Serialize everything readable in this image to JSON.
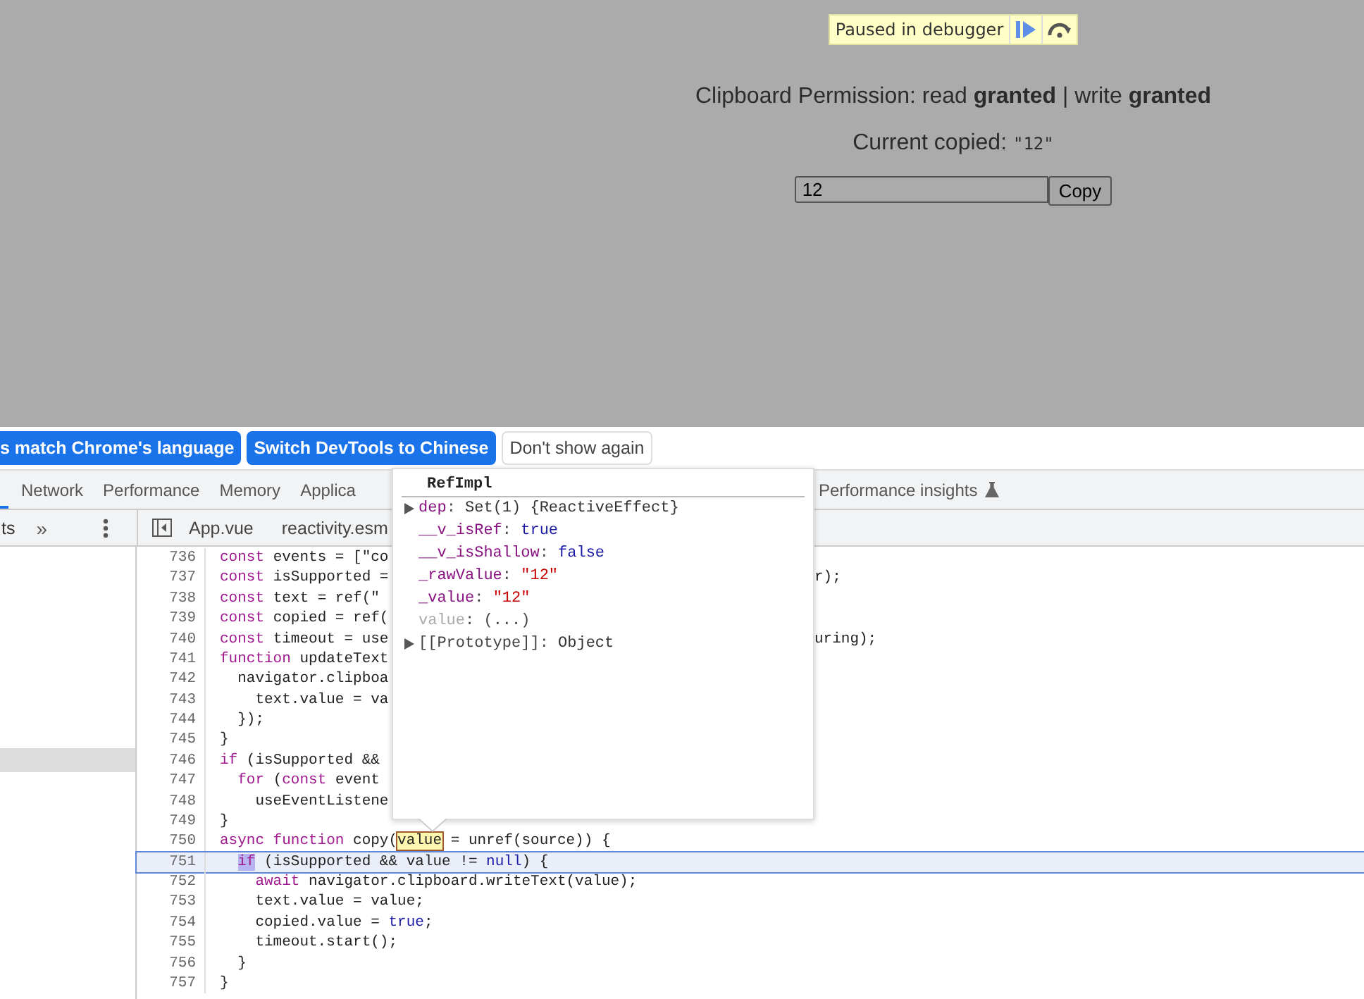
{
  "page": {
    "debugger_badge": {
      "label": "Paused in debugger"
    },
    "permission": "Clipboard Permission: read **granted** | write **granted**",
    "copied_label": "Current copied: ",
    "copied_value": "\"12\"",
    "input": {
      "value": "12"
    },
    "copy_button": "Copy"
  },
  "infobar": {
    "buttons": [
      {
        "label": "s match Chrome's language",
        "kind": "primary"
      },
      {
        "label": "Switch DevTools to Chinese",
        "kind": "primary"
      },
      {
        "label": "Don't show again",
        "kind": "plain"
      }
    ]
  },
  "tabs": [
    {
      "label": "Network",
      "selected": false
    },
    {
      "label": "Performance",
      "selected": false
    },
    {
      "label": "Memory",
      "selected": false
    },
    {
      "label": "Applica",
      "selected": false
    }
  ],
  "tabs_right": [
    {
      "label": "Performance insights",
      "experimental": true
    }
  ],
  "navigator": {
    "label": "ts",
    "more": "»"
  },
  "file_tabs": [
    {
      "label": "App.vue"
    },
    {
      "label": "reactivity.esm"
    }
  ],
  "code_lines": [
    {
      "no": "736",
      "current": false,
      "code": [
        {
          "text": "const",
          "kind": "keyword"
        },
        {
          "text": " events = [\"co"
        }
      ]
    },
    {
      "no": "737",
      "current": false,
      "code": [
        {
          "text": "const",
          "kind": "keyword"
        },
        {
          "text": " isSupported ="
        }
      ],
      "tail": "r);"
    },
    {
      "no": "738",
      "current": false,
      "code": [
        {
          "text": "const",
          "kind": "keyword"
        },
        {
          "text": " text = ref(\""
        }
      ]
    },
    {
      "no": "739",
      "current": false,
      "code": [
        {
          "text": "const",
          "kind": "keyword"
        },
        {
          "text": " copied = ref("
        }
      ]
    },
    {
      "no": "740",
      "current": false,
      "code": [
        {
          "text": "const",
          "kind": "keyword"
        },
        {
          "text": " timeout = use"
        }
      ],
      "tail": "uring);"
    },
    {
      "no": "741",
      "current": false,
      "code": [
        {
          "text": "function",
          "kind": "keyword"
        },
        {
          "text": " updateText"
        }
      ]
    },
    {
      "no": "742",
      "current": false,
      "code": [
        {
          "text": "  navigator.clipboa"
        }
      ]
    },
    {
      "no": "743",
      "current": false,
      "code": [
        {
          "text": "    text.value = va"
        }
      ]
    },
    {
      "no": "744",
      "current": false,
      "code": [
        {
          "text": "  });"
        }
      ]
    },
    {
      "no": "745",
      "current": false,
      "code": [
        {
          "text": "}"
        }
      ]
    },
    {
      "no": "746",
      "current": false,
      "code": [
        {
          "text": "if",
          "kind": "keyword"
        },
        {
          "text": " (isSupported &&"
        }
      ]
    },
    {
      "no": "747",
      "current": false,
      "code": [
        {
          "text": "  for",
          "kind": "keyword"
        },
        {
          "text": " ("
        },
        {
          "text": "const",
          "kind": "keyword"
        },
        {
          "text": " event"
        }
      ]
    },
    {
      "no": "748",
      "current": false,
      "code": [
        {
          "text": "    useEventListene"
        }
      ]
    },
    {
      "no": "749",
      "current": false,
      "code": [
        {
          "text": "}"
        }
      ]
    },
    {
      "no": "750",
      "current": false,
      "code": [
        {
          "text": "async function",
          "kind": "keyword"
        },
        {
          "text": " copy("
        },
        {
          "text": "value",
          "kind": "hovered"
        },
        {
          "text": " = unref(source)) {"
        }
      ]
    },
    {
      "no": "751",
      "current": true,
      "code": [
        {
          "text": "  if",
          "kind": "paused"
        },
        {
          "text": " (isSupported && value != "
        },
        {
          "text": "null",
          "kind": "literal"
        },
        {
          "text": ") {"
        }
      ]
    },
    {
      "no": "752",
      "current": false,
      "code": [
        {
          "text": "    await",
          "kind": "keyword"
        },
        {
          "text": " navigator.clipboard.writeText(value);"
        }
      ]
    },
    {
      "no": "753",
      "current": false,
      "code": [
        {
          "text": "    text.value = value;"
        }
      ]
    },
    {
      "no": "754",
      "current": false,
      "code": [
        {
          "text": "    copied.value = "
        },
        {
          "text": "true",
          "kind": "literal"
        },
        {
          "text": ";"
        }
      ]
    },
    {
      "no": "755",
      "current": false,
      "code": [
        {
          "text": "    timeout.start();"
        }
      ]
    },
    {
      "no": "756",
      "current": false,
      "code": [
        {
          "text": "  }"
        }
      ]
    },
    {
      "no": "757",
      "current": false,
      "code": [
        {
          "text": "}"
        }
      ]
    }
  ],
  "popover": {
    "title": "RefImpl",
    "properties": [
      {
        "name": {
          "text": "dep",
          "kind": "own"
        },
        "sep": ": ",
        "value": {
          "text": "Set(1) {ReactiveEffect}",
          "kind": "object"
        },
        "expandable": true
      },
      {
        "name": {
          "text": "__v_isRef",
          "kind": "own"
        },
        "sep": ": ",
        "value": {
          "text": "true",
          "kind": "literal"
        },
        "expandable": false
      },
      {
        "name": {
          "text": "__v_isShallow",
          "kind": "own"
        },
        "sep": ": ",
        "value": {
          "text": "false",
          "kind": "literal"
        },
        "expandable": false
      },
      {
        "name": {
          "text": "_rawValue",
          "kind": "own"
        },
        "sep": ": ",
        "value": {
          "text": "\"12\"",
          "kind": "string"
        },
        "expandable": false
      },
      {
        "name": {
          "text": "_value",
          "kind": "own"
        },
        "sep": ": ",
        "value": {
          "text": "\"12\"",
          "kind": "string"
        },
        "expandable": false
      },
      {
        "name": {
          "text": "value",
          "kind": "accessor"
        },
        "sep": ": ",
        "value": {
          "text": "(...)",
          "kind": "lazy"
        },
        "expandable": false
      },
      {
        "name": {
          "text": "[[Prototype]]",
          "kind": "internal"
        },
        "sep": ": ",
        "value": {
          "text": "Object",
          "kind": "object"
        },
        "expandable": true
      }
    ]
  }
}
